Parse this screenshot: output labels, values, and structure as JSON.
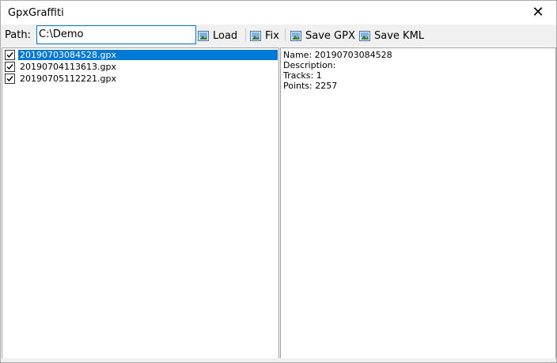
{
  "window": {
    "title": "GpxGraffiti",
    "close_glyph": "✕"
  },
  "toolbar": {
    "path_label": "Path:",
    "path_value": "C:\\Demo",
    "load_label": "Load",
    "fix_label": "Fix",
    "save_gpx_label": "Save GPX",
    "save_kml_label": "Save KML",
    "button_icon": "image-icon"
  },
  "files": [
    {
      "name": "20190703084528.gpx",
      "checked": true,
      "selected": true
    },
    {
      "name": "20190704113613.gpx",
      "checked": true,
      "selected": false
    },
    {
      "name": "20190705112221.gpx",
      "checked": true,
      "selected": false
    }
  ],
  "details": {
    "name": "Name: 20190703084528",
    "description": "Description:",
    "tracks": "Tracks: 1",
    "points": "Points: 2257"
  },
  "colors": {
    "selection": "#0078d7",
    "input_border": "#0078d7",
    "toolbar_bg": "#f0f0f0"
  }
}
